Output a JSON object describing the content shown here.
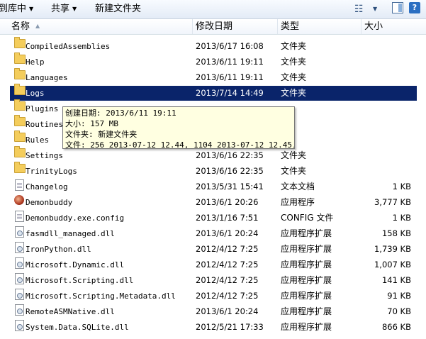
{
  "toolbar": {
    "items": [
      {
        "label": "到库中"
      },
      {
        "label": "共享"
      },
      {
        "label": "新建文件夹"
      }
    ],
    "icons": [
      "view-options-icon",
      "preview-pane-icon",
      "help-icon"
    ]
  },
  "columns": [
    {
      "label": "名称"
    },
    {
      "label": "修改日期"
    },
    {
      "label": "类型"
    },
    {
      "label": "大小"
    }
  ],
  "files": [
    {
      "name": "CompiledAssemblies",
      "date": "2013/6/17 16:08",
      "type": "文件夹",
      "size": "",
      "icon": "folder"
    },
    {
      "name": "Help",
      "date": "2013/6/11 19:11",
      "type": "文件夹",
      "size": "",
      "icon": "folder"
    },
    {
      "name": "Languages",
      "date": "2013/6/11 19:11",
      "type": "文件夹",
      "size": "",
      "icon": "folder"
    },
    {
      "name": "Logs",
      "date": "2013/7/14 14:49",
      "type": "文件夹",
      "size": "",
      "icon": "folder",
      "selected": true
    },
    {
      "name": "Plugins",
      "date": "",
      "type": "",
      "size": "",
      "icon": "folder"
    },
    {
      "name": "Routines",
      "date": "",
      "type": "",
      "size": "",
      "icon": "folder"
    },
    {
      "name": "Rules",
      "date": "",
      "type": "",
      "size": "",
      "icon": "folder"
    },
    {
      "name": "Settings",
      "date": "2013/6/16 22:35",
      "type": "文件夹",
      "size": "",
      "icon": "folder"
    },
    {
      "name": "TrinityLogs",
      "date": "2013/6/16 22:35",
      "type": "文件夹",
      "size": "",
      "icon": "folder"
    },
    {
      "name": "Changelog",
      "date": "2013/5/31 15:41",
      "type": "文本文档",
      "size": "1 KB",
      "icon": "doc"
    },
    {
      "name": "Demonbuddy",
      "date": "2013/6/1 20:26",
      "type": "应用程序",
      "size": "3,777 KB",
      "icon": "exe"
    },
    {
      "name": "Demonbuddy.exe.config",
      "date": "2013/1/16 7:51",
      "type": "CONFIG 文件",
      "size": "1 KB",
      "icon": "doc"
    },
    {
      "name": "fasmdll_managed.dll",
      "date": "2013/6/1 20:24",
      "type": "应用程序扩展",
      "size": "158 KB",
      "icon": "dll"
    },
    {
      "name": "IronPython.dll",
      "date": "2012/4/12 7:25",
      "type": "应用程序扩展",
      "size": "1,739 KB",
      "icon": "dll"
    },
    {
      "name": "Microsoft.Dynamic.dll",
      "date": "2012/4/12 7:25",
      "type": "应用程序扩展",
      "size": "1,007 KB",
      "icon": "dll"
    },
    {
      "name": "Microsoft.Scripting.dll",
      "date": "2012/4/12 7:25",
      "type": "应用程序扩展",
      "size": "141 KB",
      "icon": "dll"
    },
    {
      "name": "Microsoft.Scripting.Metadata.dll",
      "date": "2012/4/12 7:25",
      "type": "应用程序扩展",
      "size": "91 KB",
      "icon": "dll"
    },
    {
      "name": "RemoteASMNative.dll",
      "date": "2013/6/1 20:24",
      "type": "应用程序扩展",
      "size": "70 KB",
      "icon": "dll"
    },
    {
      "name": "System.Data.SQLite.dll",
      "date": "2012/5/21 17:33",
      "type": "应用程序扩展",
      "size": "866 KB",
      "icon": "dll"
    }
  ],
  "tooltip": {
    "lines": [
      "创建日期: 2013/6/11 19:11",
      "大小: 157 MB",
      "文件夹: 新建文件夹",
      "文件: 256 2013-07-12 12.44, 1104 2013-07-12 12.45, ..."
    ]
  }
}
